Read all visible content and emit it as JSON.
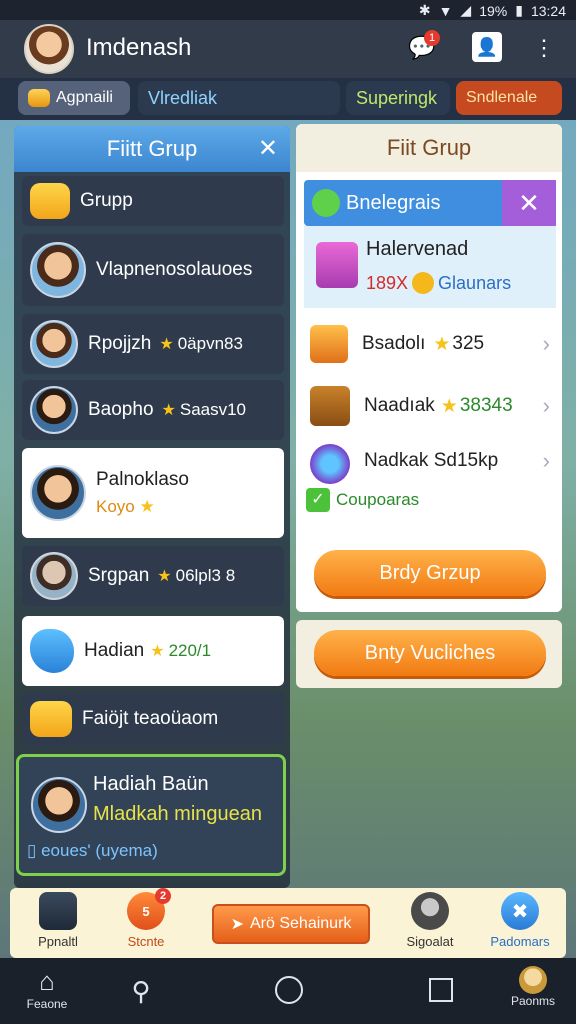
{
  "status": {
    "time": "13:24",
    "battery": "19%"
  },
  "header": {
    "title": "Imdenash",
    "chat_badge": "1"
  },
  "tabs": [
    "Agpnaili",
    "Vlredliak",
    "Superingk",
    "Sndlenale"
  ],
  "left_panel": {
    "title": "Fiitt Grup",
    "items": [
      {
        "label": "Grupp"
      },
      {
        "label": "Vlapnenosolauoes"
      },
      {
        "label": "Rpojjzh",
        "meta": "0äpvn83"
      },
      {
        "label": "Baopho",
        "meta": "Saasv10"
      },
      {
        "label": "Palnoklaso",
        "sub": "Koyo"
      },
      {
        "label": "Srgpan",
        "meta": "06lpl3 8"
      },
      {
        "label": "Hadian",
        "meta": "220/1"
      },
      {
        "label": "Faiöjt teaoüaom"
      }
    ],
    "profile": {
      "name": "Hadiah Baün",
      "subtitle": "Mladkah minguean",
      "status": "eoues' (uyema)"
    }
  },
  "right_panel": {
    "title": "Fiit Grup",
    "sub_title": "Bnelegrais",
    "highlight": {
      "name": "Halervenad",
      "value": "189X",
      "tag": "Glaunars"
    },
    "rows": [
      {
        "name": "Bsadolı",
        "value": "325"
      },
      {
        "name": "Naadıak",
        "value": "38343"
      },
      {
        "name": "Nadkak Sd15kp",
        "sub": "Coupoaras"
      }
    ],
    "buy_group": "Brdy Grzup",
    "buy_vouchers": "Bnty Vucliches"
  },
  "shortcuts": [
    {
      "label": "Ppnaltl"
    },
    {
      "label": "Stcnte",
      "badge": "5",
      "badge2": "2"
    },
    {
      "label": "Arö Sehainurk"
    },
    {
      "label": "Sigoalat"
    },
    {
      "label": "Padomars"
    }
  ],
  "navbar": {
    "home": "Feaone",
    "profile": "Paonms"
  },
  "colors": {
    "accent": "#3b86cf",
    "orange": "#f27a12",
    "dark": "#313b4a"
  }
}
